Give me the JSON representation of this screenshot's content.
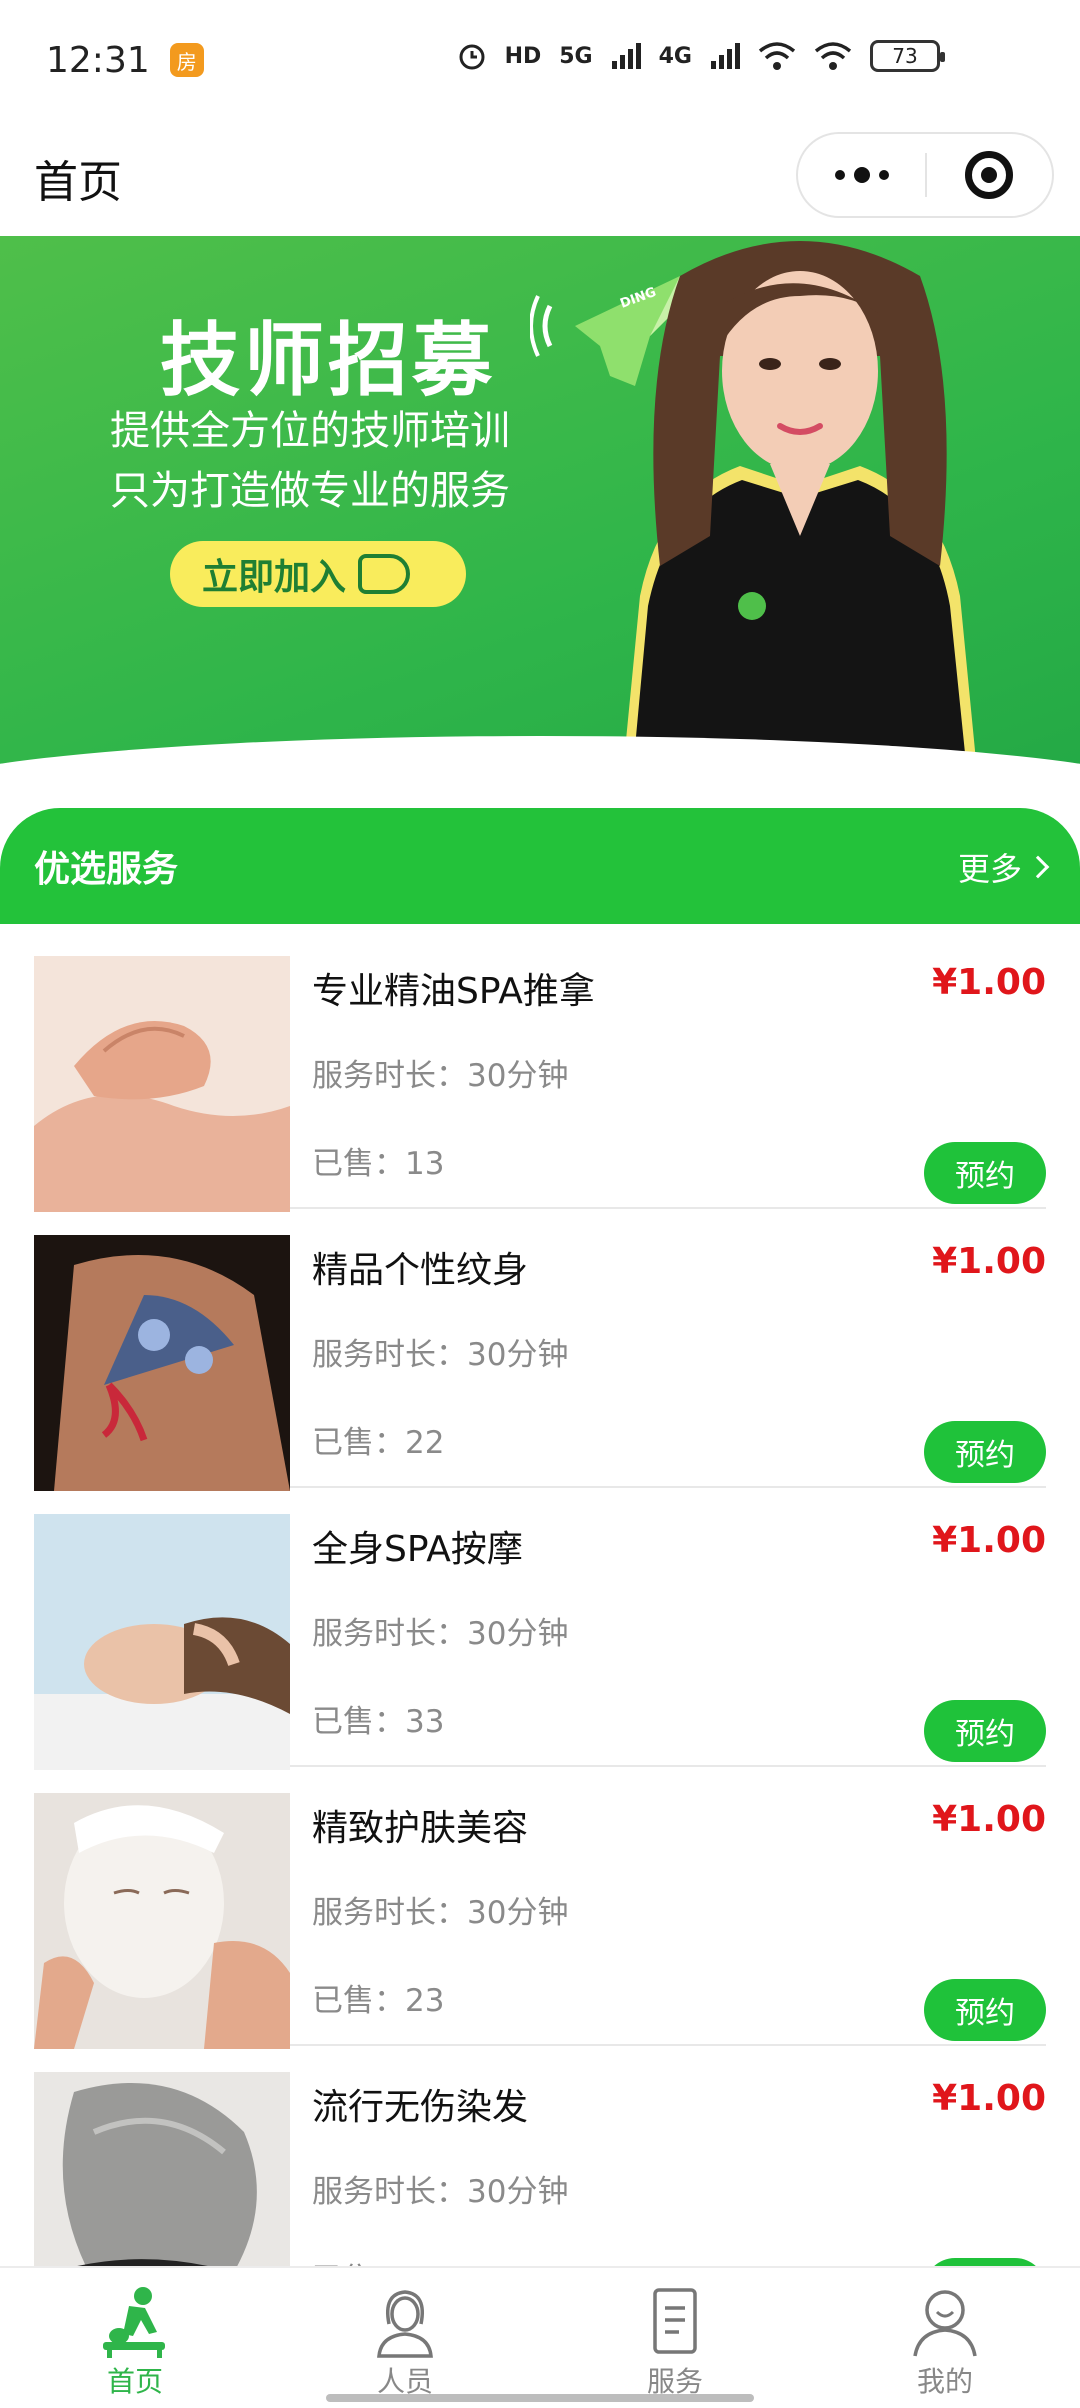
{
  "status_bar": {
    "time": "12:31",
    "app_badge": "房",
    "network_labels": [
      "HD",
      "5G",
      "4G"
    ],
    "battery": "73"
  },
  "nav": {
    "title": "首页"
  },
  "banner": {
    "title": "技师招募",
    "subtitle_line1": "提供全方位的技师培训",
    "subtitle_line2": "只为打造做专业的服务",
    "button_label": "立即加入",
    "megaphone_text": "DING",
    "active_slide": 2,
    "slide_count": 2
  },
  "section": {
    "title": "优选服务",
    "more_label": "更多"
  },
  "services": [
    {
      "name": "专业精油SPA推拿",
      "price": "¥1.00",
      "duration": "服务时长：30分钟",
      "sold": "已售：13",
      "button": "预约"
    },
    {
      "name": "精品个性纹身",
      "price": "¥1.00",
      "duration": "服务时长：30分钟",
      "sold": "已售：22",
      "button": "预约"
    },
    {
      "name": "全身SPA按摩",
      "price": "¥1.00",
      "duration": "服务时长：30分钟",
      "sold": "已售：33",
      "button": "预约"
    },
    {
      "name": "精致护肤美容",
      "price": "¥1.00",
      "duration": "服务时长：30分钟",
      "sold": "已售：23",
      "button": "预约"
    },
    {
      "name": "流行无伤染发",
      "price": "¥1.00",
      "duration": "服务时长：30分钟",
      "sold": "已售：",
      "button": "预约"
    }
  ],
  "tabs": [
    {
      "label": "首页",
      "icon": "home-massage-icon",
      "active": true
    },
    {
      "label": "人员",
      "icon": "staff-icon",
      "active": false
    },
    {
      "label": "服务",
      "icon": "document-icon",
      "active": false
    },
    {
      "label": "我的",
      "icon": "user-icon",
      "active": false
    }
  ],
  "colors": {
    "brand_green": "#23c23a",
    "price_red": "#e0161b",
    "banner_yellow": "#f9ec5c"
  }
}
